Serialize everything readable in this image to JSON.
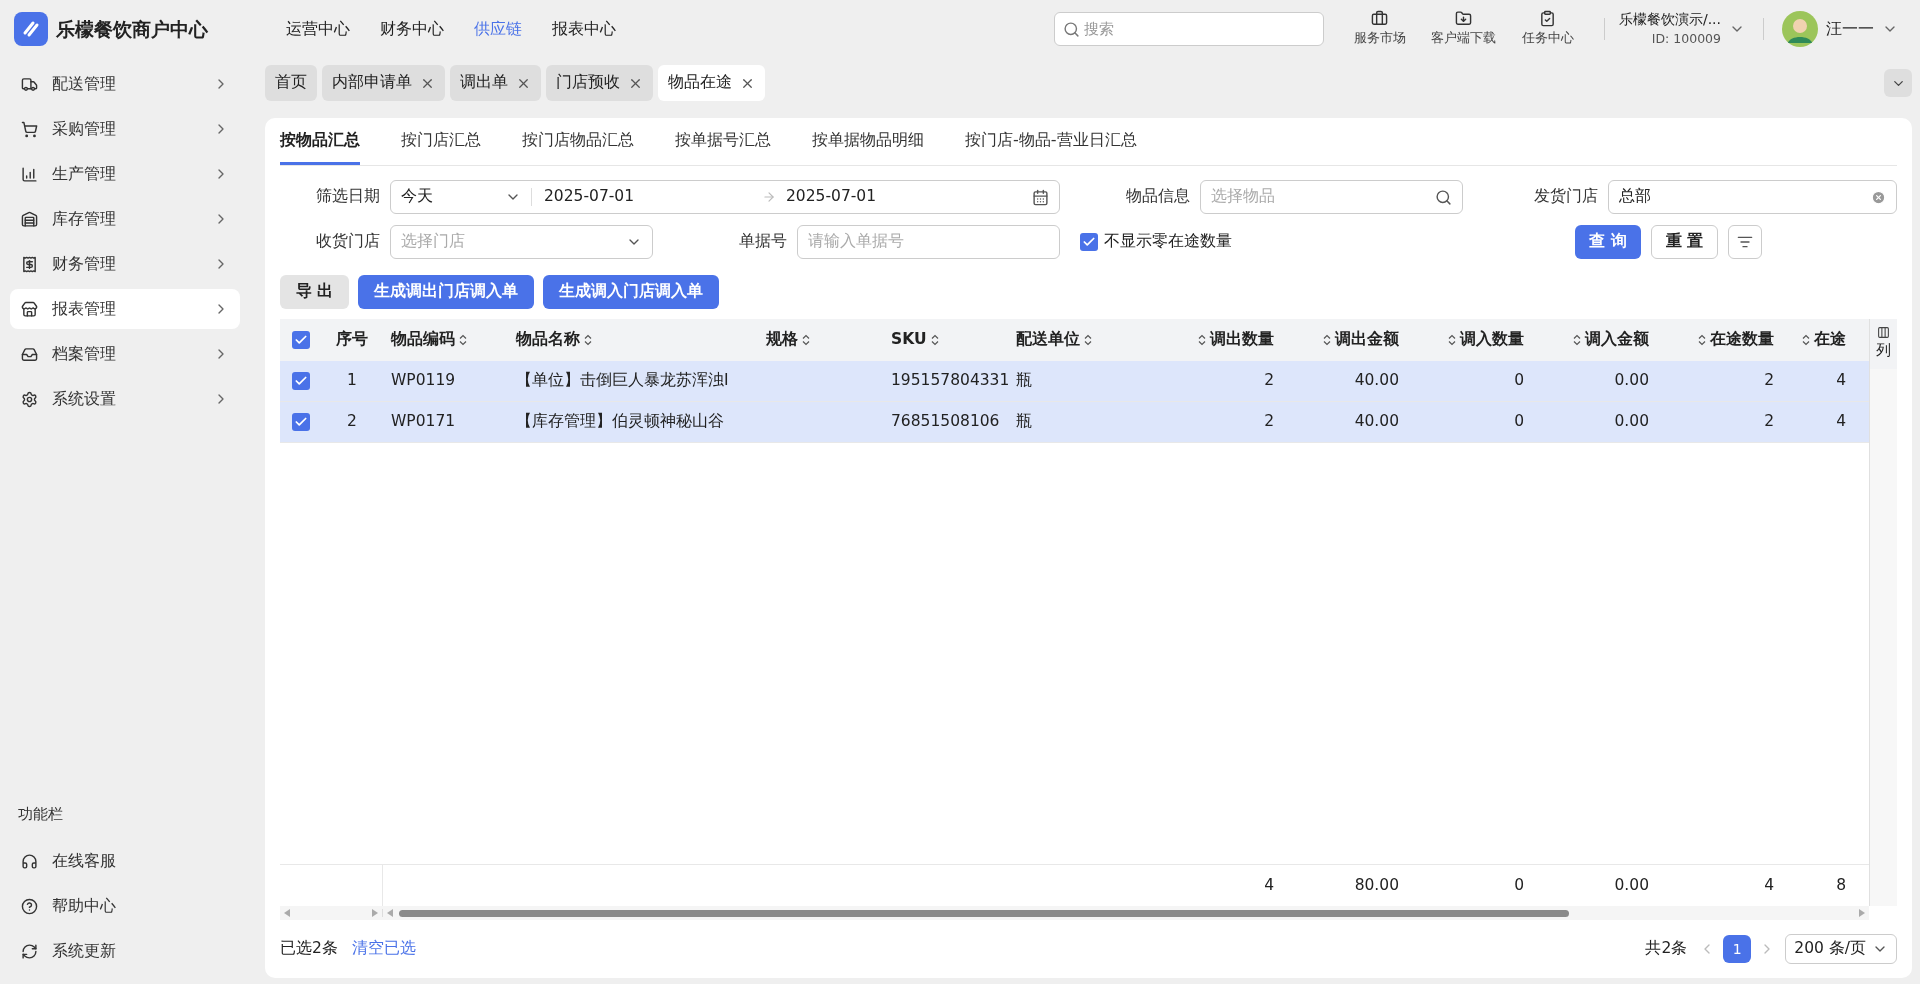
{
  "app": {
    "title": "乐檬餐饮商户中心"
  },
  "nav": [
    {
      "label": "运营中心",
      "selected": false
    },
    {
      "label": "财务中心",
      "selected": false
    },
    {
      "label": "供应链",
      "selected": true
    },
    {
      "label": "报表中心",
      "selected": false
    }
  ],
  "search": {
    "placeholder": "搜索"
  },
  "tools": [
    {
      "label": "服务市场"
    },
    {
      "label": "客户端下载"
    },
    {
      "label": "任务中心"
    }
  ],
  "account": {
    "name": "乐檬餐饮演示/...",
    "id": "ID: 100009",
    "user": "汪一一"
  },
  "sidebar": {
    "items": [
      {
        "label": "配送管理",
        "selected": false
      },
      {
        "label": "采购管理",
        "selected": false
      },
      {
        "label": "生产管理",
        "selected": false
      },
      {
        "label": "库存管理",
        "selected": false
      },
      {
        "label": "财务管理",
        "selected": false
      },
      {
        "label": "报表管理",
        "selected": true
      },
      {
        "label": "档案管理",
        "selected": false
      },
      {
        "label": "系统设置",
        "selected": false
      }
    ],
    "section_title": "功能栏",
    "footer_items": [
      {
        "label": "在线客服"
      },
      {
        "label": "帮助中心"
      },
      {
        "label": "系统更新"
      }
    ]
  },
  "page_tabs": [
    {
      "label": "首页",
      "selected": false,
      "closable": false
    },
    {
      "label": "内部申请单",
      "selected": false,
      "closable": true
    },
    {
      "label": "调出单",
      "selected": false,
      "closable": true
    },
    {
      "label": "门店预收",
      "selected": false,
      "closable": true
    },
    {
      "label": "物品在途",
      "selected": true,
      "closable": true
    }
  ],
  "sub_tabs": [
    {
      "label": "按物品汇总",
      "selected": true
    },
    {
      "label": "按门店汇总",
      "selected": false
    },
    {
      "label": "按门店物品汇总",
      "selected": false
    },
    {
      "label": "按单据号汇总",
      "selected": false
    },
    {
      "label": "按单据物品明细",
      "selected": false
    },
    {
      "label": "按门店-物品-营业日汇总",
      "selected": false
    }
  ],
  "filters": {
    "date": {
      "label": "筛选日期",
      "preset": "今天",
      "start": "2025-07-01",
      "end": "2025-07-01"
    },
    "item": {
      "label": "物品信息",
      "placeholder": "选择物品"
    },
    "ship_store": {
      "label": "发货门店",
      "value": "总部"
    },
    "receive_store": {
      "label": "收货门店",
      "placeholder": "选择门店"
    },
    "doc_no": {
      "label": "单据号",
      "placeholder": "请输入单据号"
    },
    "hide_zero": {
      "label": "不显示零在途数量",
      "checked": true
    },
    "query": "查 询",
    "reset": "重 置"
  },
  "actions": [
    {
      "label": "导 出",
      "kind": "secondary"
    },
    {
      "label": "生成调出门店调入单",
      "kind": "primary"
    },
    {
      "label": "生成调入门店调入单",
      "kind": "primary"
    }
  ],
  "table": {
    "all_checked": true,
    "columns": [
      {
        "label": "序号",
        "kind": "index",
        "sortable": false
      },
      {
        "label": "物品编码",
        "kind": "text",
        "sortable": true
      },
      {
        "label": "物品名称",
        "kind": "text",
        "sortable": true
      },
      {
        "label": "规格",
        "kind": "text",
        "sortable": true
      },
      {
        "label": "SKU",
        "kind": "text",
        "sortable": true
      },
      {
        "label": "配送单位",
        "kind": "text",
        "sortable": true
      },
      {
        "label": "调出数量",
        "kind": "number",
        "sortable": true
      },
      {
        "label": "调出金额",
        "kind": "number",
        "sortable": true
      },
      {
        "label": "调入数量",
        "kind": "number",
        "sortable": true
      },
      {
        "label": "调入金额",
        "kind": "number",
        "sortable": true
      },
      {
        "label": "在途数量",
        "kind": "number",
        "sortable": true
      },
      {
        "label": "在途",
        "kind": "number",
        "sortable": true
      }
    ],
    "settings_label": "列",
    "rows": [
      {
        "selected": true,
        "seq": "1",
        "code": "WP0119",
        "name": "【单位】击倒巨人暴龙苏浑浊I",
        "sku": "195157804331",
        "unit": "瓶",
        "out_qty": "2",
        "out_amount": "40.00",
        "in_qty": "0",
        "in_amount": "0.00",
        "transit_qty": "2",
        "transit_amount": "4"
      },
      {
        "selected": true,
        "seq": "2",
        "code": "WP0171",
        "name": "【库存管理】伯灵顿神秘山谷",
        "sku": "76851508106",
        "unit": "瓶",
        "out_qty": "2",
        "out_amount": "40.00",
        "in_qty": "0",
        "in_amount": "0.00",
        "transit_qty": "2",
        "transit_amount": "4"
      }
    ],
    "summary": {
      "out_qty": "4",
      "out_amount": "80.00",
      "in_qty": "0",
      "in_amount": "0.00",
      "transit_qty": "4",
      "transit_amount": "8"
    }
  },
  "footer": {
    "selected_count": "已选2条",
    "clear": "清空已选",
    "total": "共2条",
    "page": "1",
    "page_size": "200 条/页"
  }
}
